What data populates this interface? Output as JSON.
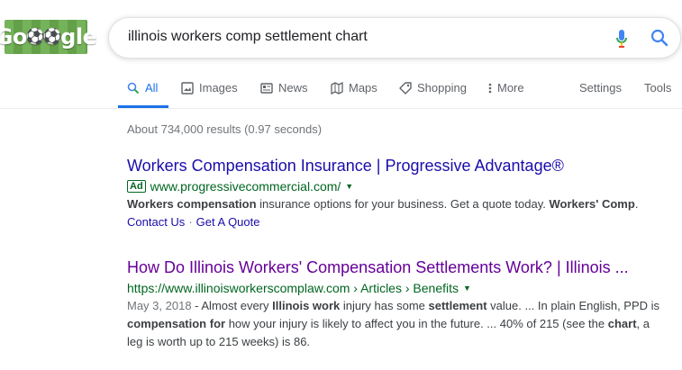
{
  "logo": {
    "text_a": "Go",
    "ball_a": "⚽",
    "ball_b": "⚽",
    "text_b": "gle"
  },
  "search": {
    "query": "illinois workers comp settlement chart"
  },
  "tabs": [
    {
      "label": "All",
      "icon": "search-icon"
    },
    {
      "label": "Images",
      "icon": "image-icon"
    },
    {
      "label": "News",
      "icon": "news-icon"
    },
    {
      "label": "Maps",
      "icon": "map-icon"
    },
    {
      "label": "Shopping",
      "icon": "tag-icon"
    },
    {
      "label": "More",
      "icon": "kebab-icon"
    }
  ],
  "tools": {
    "settings": "Settings",
    "tools": "Tools"
  },
  "stats": "About 734,000 results (0.97 seconds)",
  "results": [
    {
      "title": "Workers Compensation Insurance | Progressive Advantage®",
      "ad_label": "Ad",
      "url": "www.progressivecommercial.com/",
      "snippet": {
        "b1": "Workers compensation",
        "t1": " insurance options for your business. Get a quote today. ",
        "b2": "Workers' Comp",
        "t2": "."
      },
      "sitelinks": [
        "Contact Us",
        "Get A Quote"
      ]
    },
    {
      "title": "How Do Illinois Workers' Compensation Settlements Work? | Illinois ...",
      "url": "https://www.illinoisworkerscomplaw.com › Articles › Benefits",
      "snippet": {
        "date": "May 3, 2018",
        "t1": " - Almost every ",
        "b1": "Illinois work",
        "t2": " injury has some ",
        "b2": "settlement",
        "t3": " value. ... In plain English, PPD is",
        "b3": "compensation for",
        "t4": " how your injury is likely to affect you in the future. ... 40% of 215 (see the ",
        "b4": "chart",
        "t5": ", a",
        "t6": "leg is worth up to 215 weeks) is 86."
      }
    }
  ],
  "colors": {
    "link": "#1a0dab",
    "visited": "#660099",
    "url": "#006621",
    "accent": "#1a73e8"
  }
}
